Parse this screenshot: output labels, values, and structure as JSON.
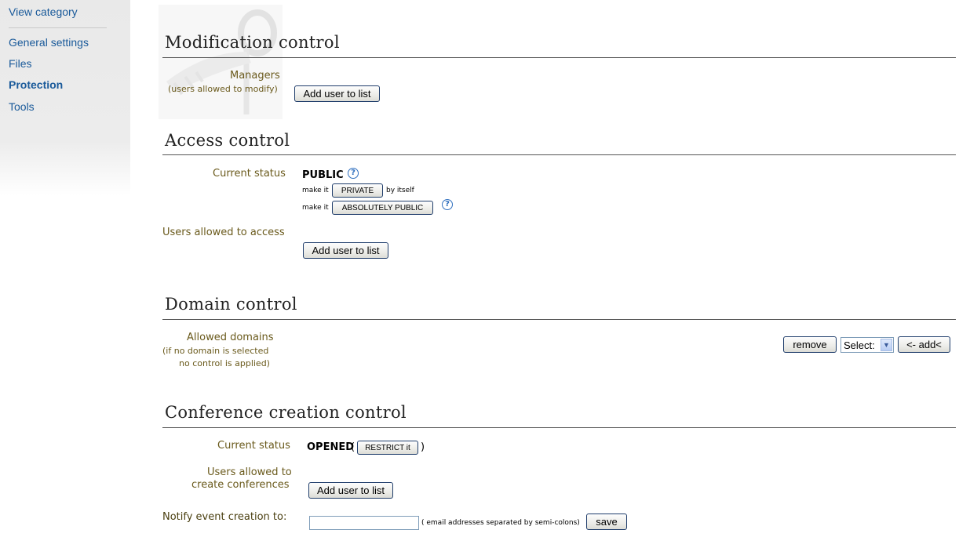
{
  "sidebar": {
    "items": [
      {
        "label": "View category"
      },
      {
        "label": "General settings"
      },
      {
        "label": "Files"
      },
      {
        "label": "Protection"
      },
      {
        "label": "Tools"
      }
    ]
  },
  "modification": {
    "title": "Modification control",
    "managers_label": "Managers",
    "managers_sublabel": "(users allowed to modify)",
    "add_user_button": "Add user to list"
  },
  "access": {
    "title": "Access control",
    "current_status_label": "Current status",
    "status_value": "PUBLIC",
    "make_it_1": "make it",
    "private_button": "PRIVATE",
    "by_itself": "by itself",
    "make_it_2": "make it",
    "absolutely_public_button": "ABSOLUTELY PUBLIC",
    "users_allowed_label": "Users allowed to access",
    "add_user_button": "Add user to list",
    "help_glyph": "?"
  },
  "domain": {
    "title": "Domain control",
    "allowed_label": "Allowed domains",
    "sublabel_1": "(if no domain is selected",
    "sublabel_2": "no control is applied)",
    "remove_button": "remove",
    "select_value": "Select:",
    "add_button": "<- add<"
  },
  "conference": {
    "title": "Conference creation control",
    "current_status_label": "Current status",
    "status_value": "OPENED",
    "open_paren": "(",
    "restrict_button": "RESTRICT it",
    "close_paren": ")",
    "users_allowed_line1": "Users allowed to",
    "users_allowed_line2": "create conferences",
    "add_user_button": "Add user to list",
    "notify_label": "Notify event creation to:",
    "email_value": "",
    "email_hint": "( email addresses separated by semi-colons)",
    "save_button": "save"
  },
  "colors": {
    "link": "#1a5a9a",
    "label": "#6a5a1c",
    "button_border": "#1f3d6b",
    "help": "#2f6fbf"
  },
  "icons": [
    "key-watermark-icon",
    "help-icon",
    "chevron-down-icon"
  ]
}
